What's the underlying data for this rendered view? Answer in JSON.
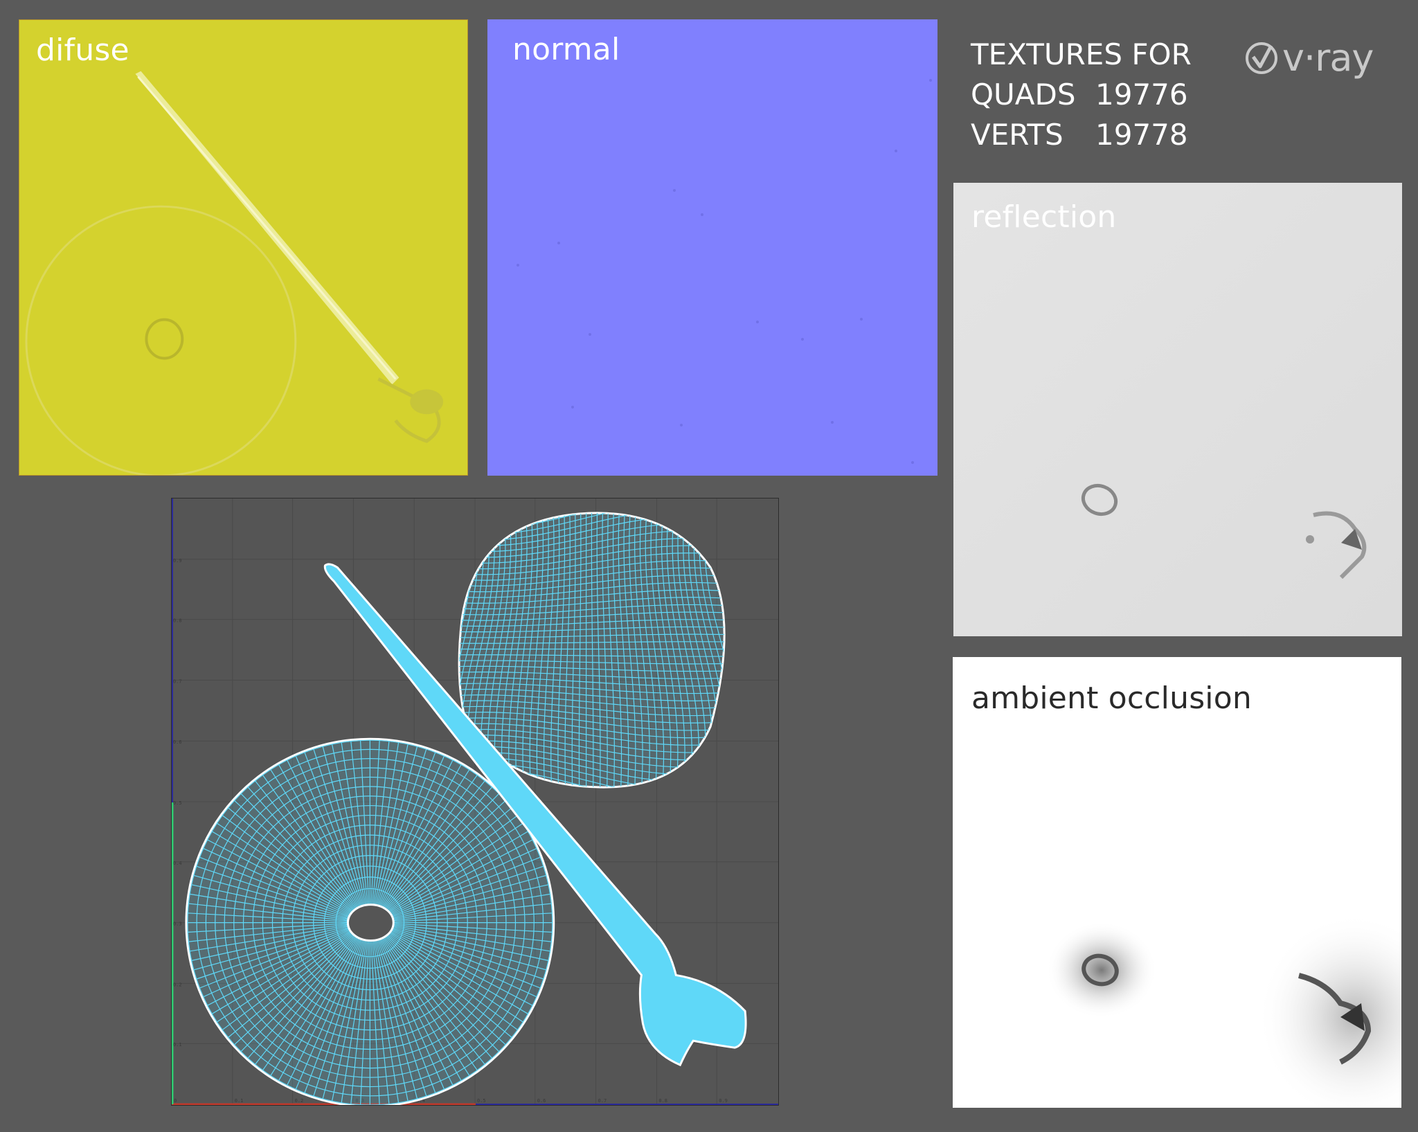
{
  "panels": {
    "diffuse": {
      "label": "difuse",
      "color": "#d4d22e"
    },
    "normal": {
      "label": "normal",
      "color": "#8080fe"
    },
    "reflection": {
      "label": "reflection",
      "color": "#e1e1e1"
    },
    "ambient_occlusion": {
      "label": "ambient occlusion",
      "color": "#ffffff"
    }
  },
  "info": {
    "title": "TEXTURES FOR",
    "quads_label": "QUADS",
    "quads_value": "19776",
    "verts_label": "VERTS",
    "verts_value": "19778"
  },
  "logo": {
    "text": "v·ray",
    "icon": "vray-check-icon"
  },
  "uv_editor": {
    "x_ticks": [
      "0",
      "0.1",
      "0.2",
      "0.3",
      "0.4",
      "0.5",
      "0.6",
      "0.7",
      "0.8",
      "0.9"
    ],
    "y_ticks": [
      "0.1",
      "0.2",
      "0.3",
      "0.4",
      "0.5",
      "0.6",
      "0.7",
      "0.8",
      "0.9"
    ],
    "wire_color": "#5fd8f8",
    "axis_u_color": "#c0392b",
    "axis_v_color": "#2ecc71"
  }
}
